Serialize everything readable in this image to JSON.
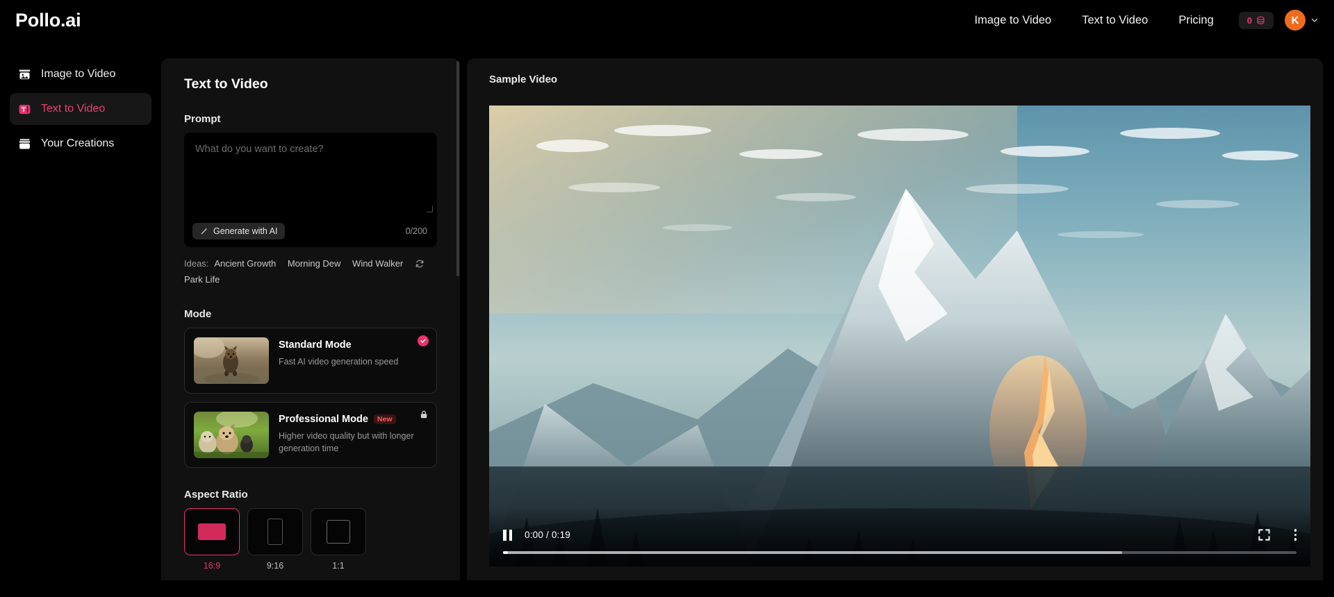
{
  "brand": {
    "name": "Pollo.ai"
  },
  "topnav": {
    "links": [
      {
        "label": "Image to Video"
      },
      {
        "label": "Text to Video"
      },
      {
        "label": "Pricing"
      }
    ],
    "credits": {
      "value": "0",
      "icon": "coin-stack-icon"
    },
    "account": {
      "initial": "K"
    }
  },
  "sidebar": {
    "items": [
      {
        "label": "Image to Video",
        "icon": "image-icon",
        "active": false
      },
      {
        "label": "Text to Video",
        "icon": "text-video-icon",
        "active": true
      },
      {
        "label": "Your Creations",
        "icon": "creations-icon",
        "active": false
      }
    ]
  },
  "panel": {
    "title": "Text to Video",
    "prompt": {
      "label": "Prompt",
      "value": "",
      "placeholder": "What do you want to create?",
      "generate_button": "Generate with AI",
      "counter": "0/200"
    },
    "ideas": {
      "label": "Ideas:",
      "chips": [
        "Ancient Growth",
        "Morning Dew",
        "Wind Walker",
        "Park Life"
      ],
      "refresh_icon": "refresh-icon"
    },
    "mode": {
      "label": "Mode",
      "options": [
        {
          "title": "Standard Mode",
          "description": "Fast AI video generation speed",
          "selected": true,
          "badge": "",
          "locked": false
        },
        {
          "title": "Professional Mode",
          "description": "Higher video quality but with longer generation time",
          "selected": false,
          "badge": "New",
          "locked": true
        }
      ]
    },
    "aspect_ratio": {
      "label": "Aspect Ratio",
      "options": [
        {
          "label": "16:9",
          "selected": true
        },
        {
          "label": "9:16",
          "selected": false
        },
        {
          "label": "1:1",
          "selected": false
        }
      ]
    }
  },
  "stage": {
    "title": "Sample Video",
    "player": {
      "state": "playing",
      "current_time": "0:00",
      "duration": "0:19",
      "time_display": "0:00 / 0:19",
      "played_percent": 0.6,
      "buffered_percent": 78,
      "fullscreen_icon": "fullscreen-icon",
      "more_icon": "more-vertical-icon",
      "pause_icon": "pause-icon"
    }
  },
  "colors": {
    "accent": "#e8336b",
    "accent_text": "#e8406f",
    "avatar": "#ee6c1f",
    "panel_bg": "#111111",
    "page_bg": "#000000"
  }
}
